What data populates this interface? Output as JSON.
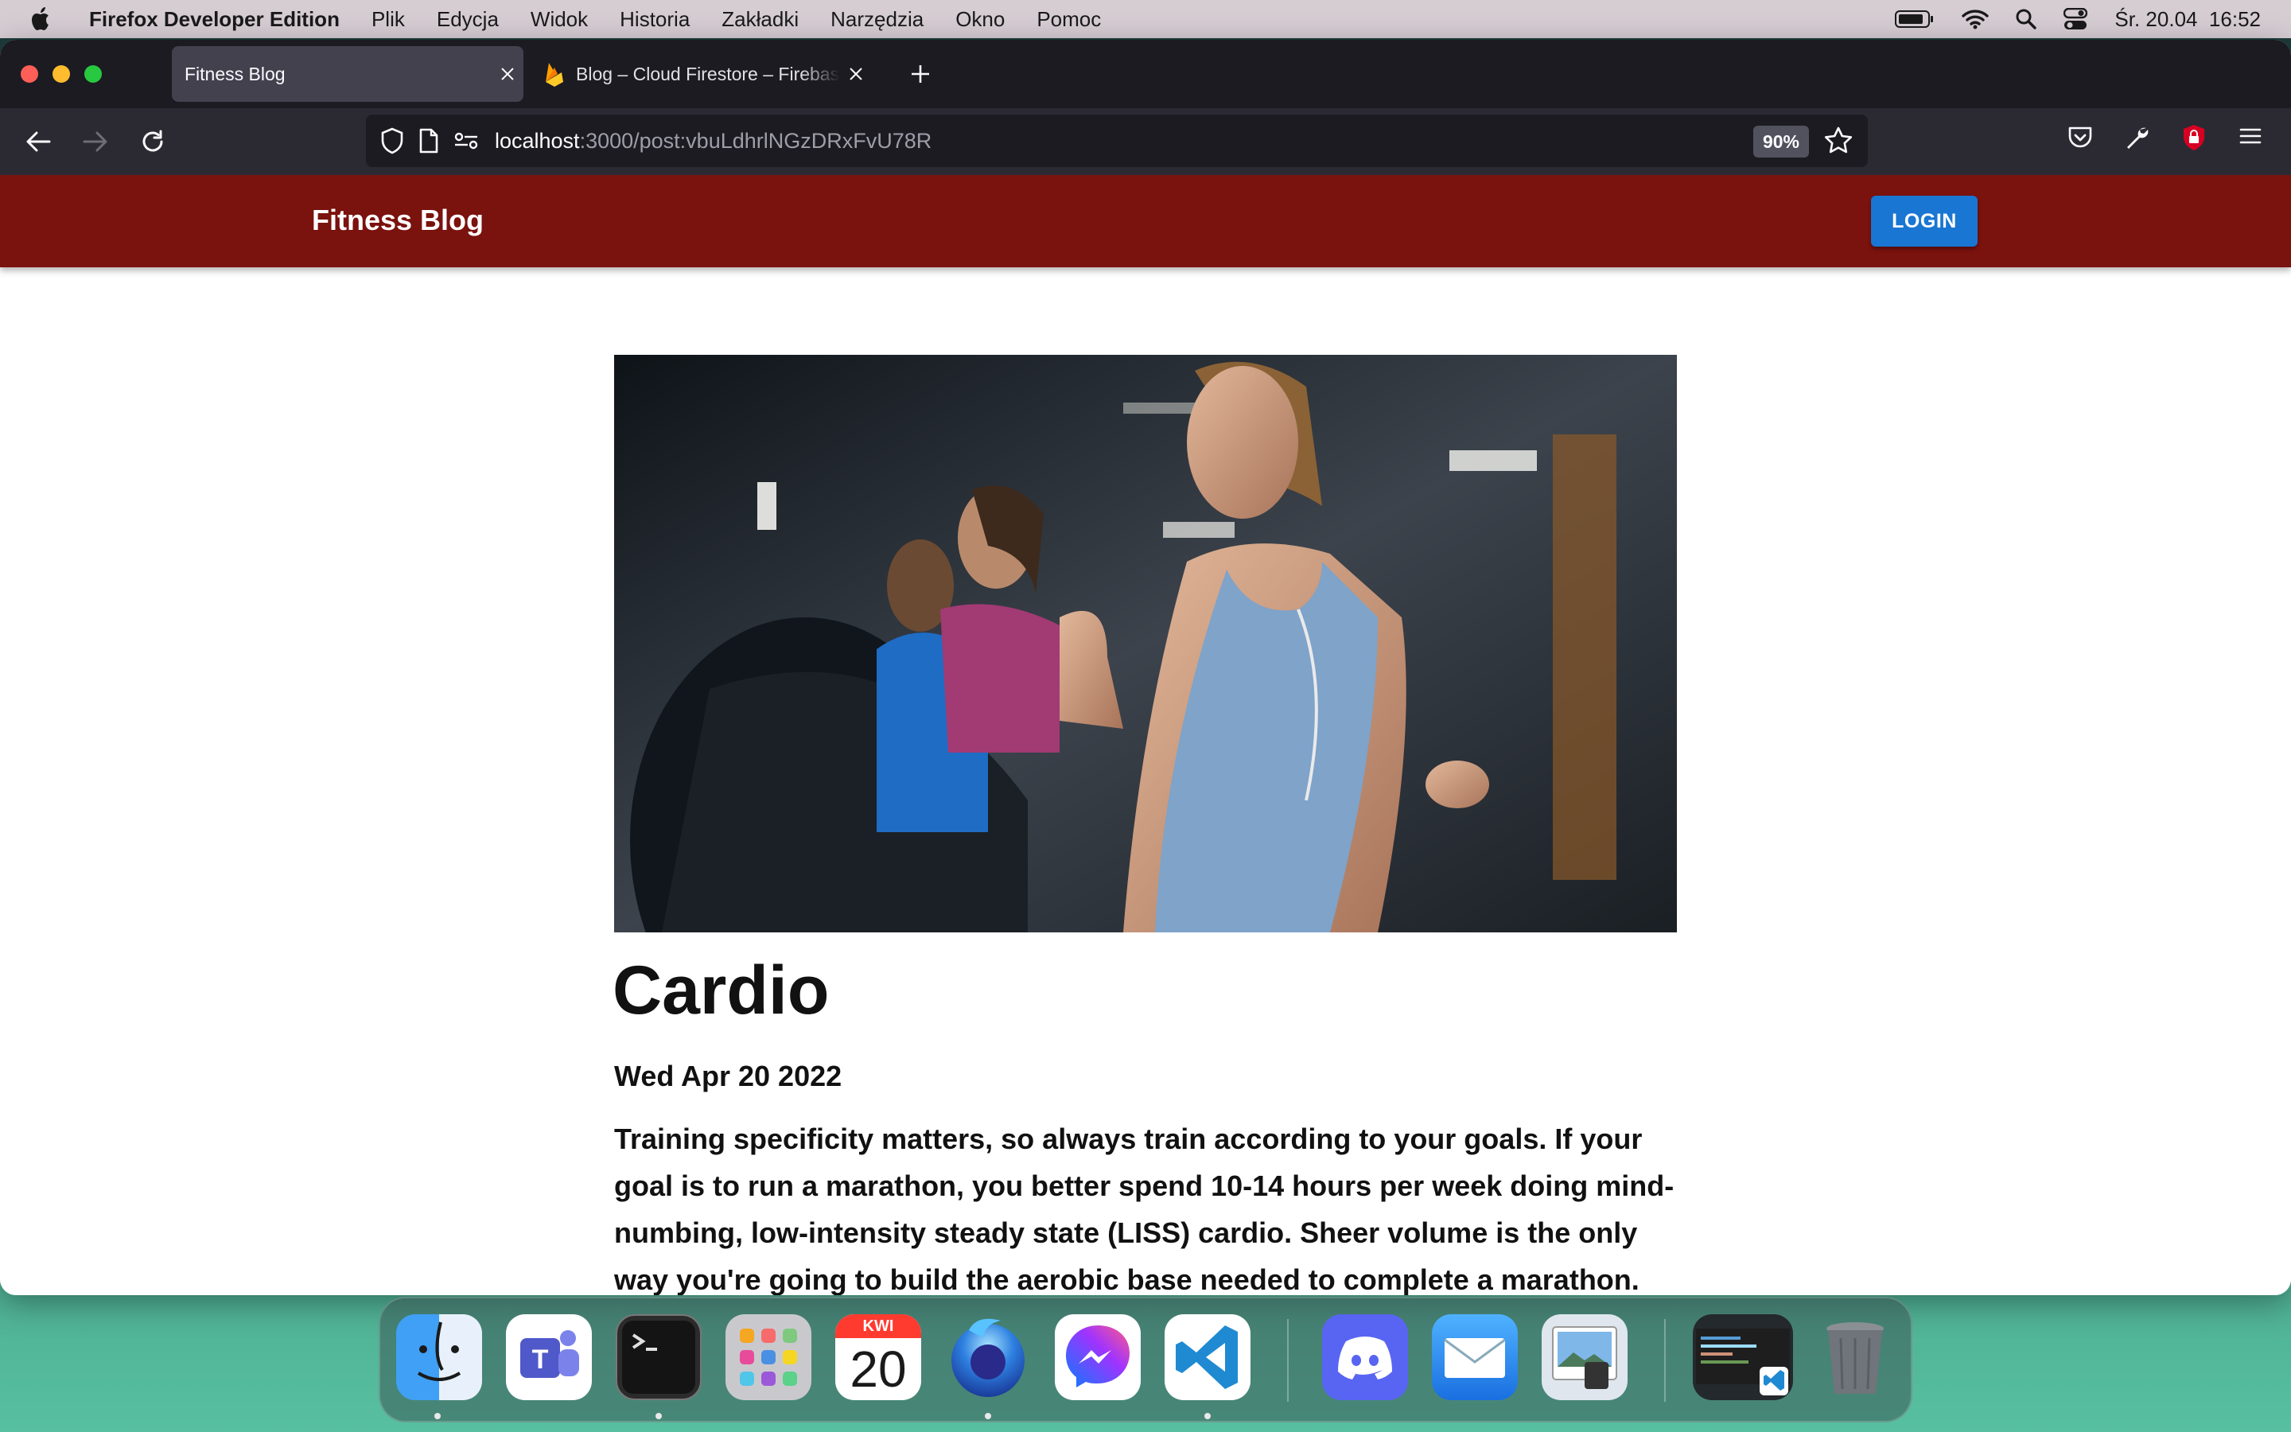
{
  "menubar": {
    "app_name": "Firefox Developer Edition",
    "items": [
      "Plik",
      "Edycja",
      "Widok",
      "Historia",
      "Zakładki",
      "Narzędzia",
      "Okno",
      "Pomoc"
    ],
    "datetime": "Śr. 20.04  16:52"
  },
  "browser": {
    "tabs": [
      {
        "label": "Fitness Blog",
        "active": true
      },
      {
        "label": "Blog – Cloud Firestore – Firebase",
        "active": false
      }
    ],
    "url": {
      "host": "localhost",
      "path": ":3000/post:vbuLdhrlNGzDRxFvU78R"
    },
    "zoom": "90%"
  },
  "site": {
    "brand": "Fitness Blog",
    "login_label": "LOGIN",
    "accent": "#7a120e",
    "button_color": "#1976d2"
  },
  "post": {
    "title": "Cardio",
    "date": "Wed Apr 20 2022",
    "body": "Training specificity matters, so always train according to your goals. If your goal is to run a marathon, you better spend 10-14 hours per week doing mind-numbing, low-intensity steady state (LISS) cardio. Sheer volume is the only way you're going to build the aerobic base needed to complete a marathon. But if your goal is to be strong, muscular, and aerobically fit, then keep your"
  },
  "dock": {
    "calendar_month": "KWI",
    "calendar_day": "20",
    "apps": [
      "finder-icon",
      "teams-icon",
      "terminal-icon",
      "launchpad-icon",
      "calendar-icon",
      "firefox-icon",
      "messenger-icon",
      "vscode-icon",
      "discord-icon",
      "mail-icon",
      "preview-icon",
      "vscode-window-icon",
      "trash-icon"
    ]
  }
}
